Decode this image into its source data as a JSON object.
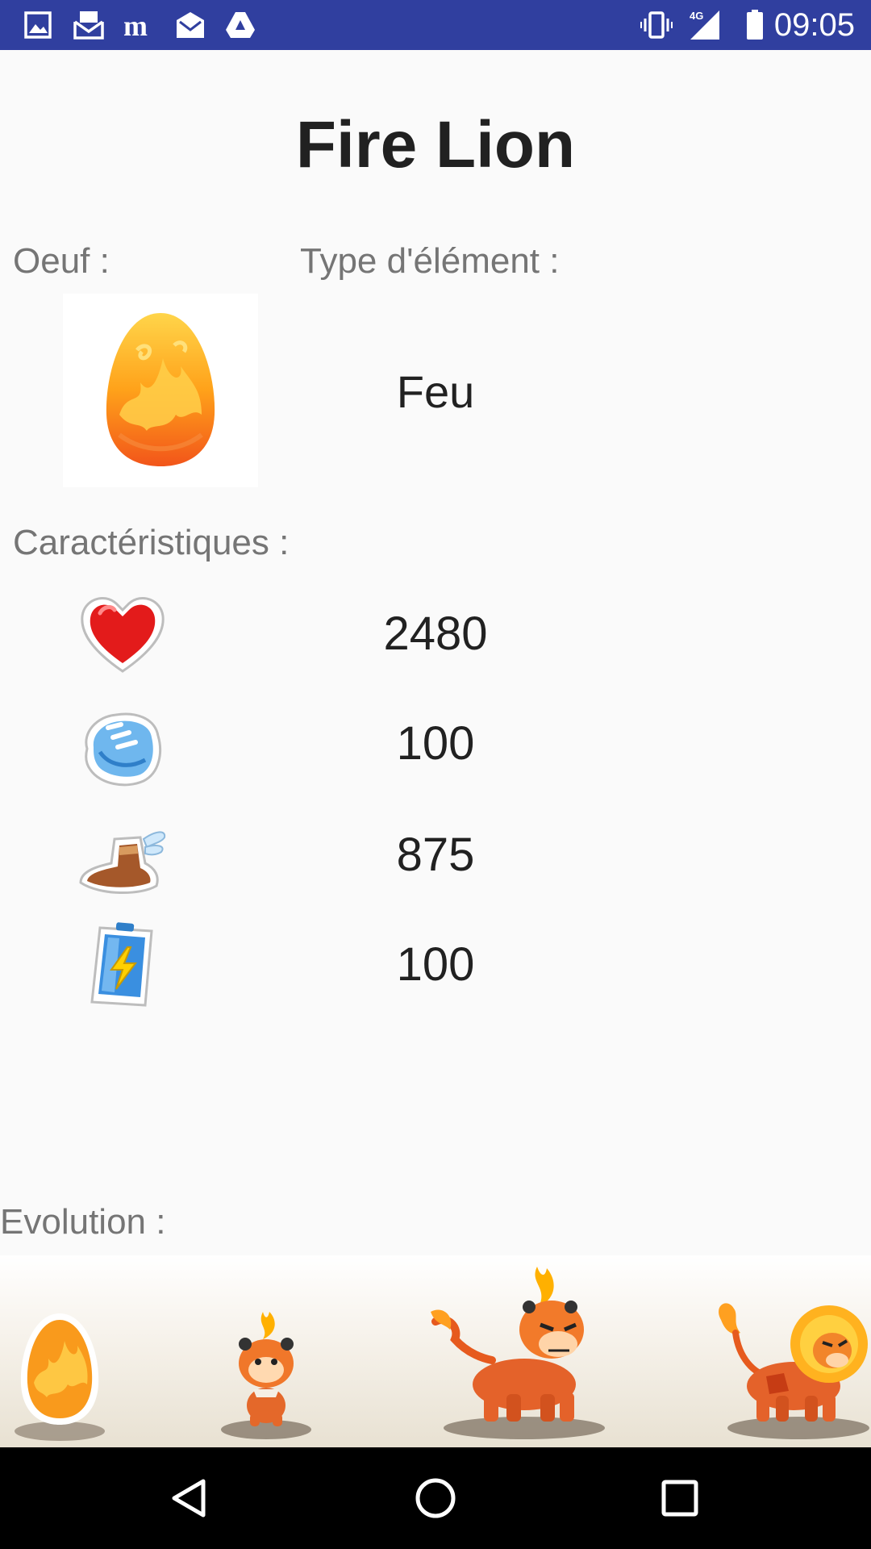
{
  "status_bar": {
    "time": "09:05",
    "network": "4G",
    "left_icons": [
      "gallery-icon",
      "mail-stack-icon",
      "le-monde-icon",
      "mail-icon",
      "drive-icon"
    ],
    "right_icons": [
      "vibrate-icon",
      "signal-icon",
      "battery-icon"
    ],
    "background": "#303f9f"
  },
  "page": {
    "title": "Fire Lion"
  },
  "egg": {
    "label": "Oeuf :",
    "image": "fire-egg-icon"
  },
  "element": {
    "label": "Type d'élément :",
    "value": "Feu"
  },
  "characteristics": {
    "label": "Caractéristiques :",
    "stats": [
      {
        "icon": "heart-icon",
        "value": "2480"
      },
      {
        "icon": "fist-icon",
        "value": "100"
      },
      {
        "icon": "winged-boot-icon",
        "value": "875"
      },
      {
        "icon": "battery-energy-icon",
        "value": "100"
      }
    ]
  },
  "evolution": {
    "label": "Evolution :",
    "stages": [
      "fire-egg-icon",
      "baby-fire-lion-icon",
      "young-fire-lion-icon",
      "adult-fire-lion-icon"
    ]
  },
  "nav_bar": {
    "buttons": [
      "back-icon",
      "home-icon",
      "recents-icon"
    ]
  }
}
